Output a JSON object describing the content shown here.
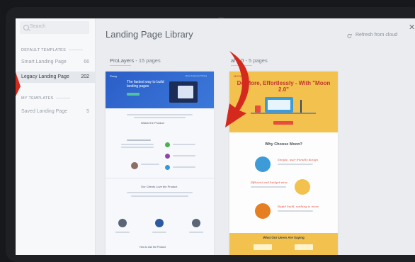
{
  "sidebar": {
    "search_placeholder": "Search",
    "default_section": "DEFAULT TEMPLATES",
    "my_section": "MY TEMPLATES",
    "items": [
      {
        "label": "Smart Landing Page",
        "count": "66"
      },
      {
        "label": "Legacy Landing Page",
        "count": "202"
      },
      {
        "label": "Saved Landing Page",
        "count": "5"
      }
    ]
  },
  "header": {
    "title": "Landing Page Library",
    "refresh_label": "Refresh from cloud"
  },
  "groups": [
    {
      "name": "ProLayers",
      "count": "15 pages"
    },
    {
      "name": "al 2.0",
      "count": "5 pages"
    }
  ],
  "card1": {
    "logo": "Prosy",
    "nav": "Home  Features  Pricing",
    "headline": "The fastest way to build landing pages",
    "tagline": "Watch the Product",
    "section2": "Our Clients Love the Product",
    "bottom": "How to Use the Product"
  },
  "card2": {
    "logo": "MOON",
    "headline": "Do More, Effortlessly - With \"Moon 2.0\"",
    "why": "Why Choose Moon?",
    "script1": "Simple, user friendly design",
    "script2": "Efficient and budget-wise",
    "script3": "Rapid build, nothing is more",
    "users": "What Our Users Are Saying"
  },
  "colors": {
    "accent_red": "#d42a1e",
    "sidebar_active": "#e4e7eb",
    "card1_hero": "#2b5ec8",
    "card2_hero": "#f2c14e"
  }
}
